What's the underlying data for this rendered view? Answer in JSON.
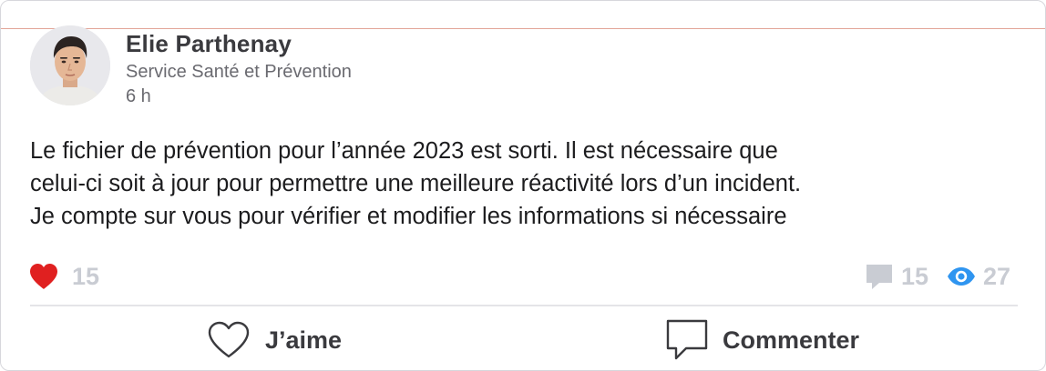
{
  "post": {
    "author": {
      "name": "Elie Parthenay",
      "department": "Service Santé et Prévention"
    },
    "time": "6 h",
    "body": "Le fichier de prévention pour l’année 2023 est sorti. Il est nécessaire que\ncelui-ci soit à jour pour permettre une meilleure réactivité lors d’un incident.\nJe compte sur vous pour vérifier et modifier les informations si nécessaire",
    "stats": {
      "likes": "15",
      "comments": "15",
      "views": "27"
    },
    "actions": {
      "like_label": "J’aime",
      "comment_label": "Commenter"
    }
  },
  "icons": {
    "likes": "heart-filled-icon",
    "comments": "speech-bubble-icon",
    "views": "eye-icon",
    "like_action": "heart-outline-icon",
    "comment_action": "comment-outline-icon"
  },
  "colors": {
    "heart": "#e02020",
    "eye": "#2f95f0",
    "muted_stat": "#c9ccd3",
    "text": "#1c1c1e"
  }
}
